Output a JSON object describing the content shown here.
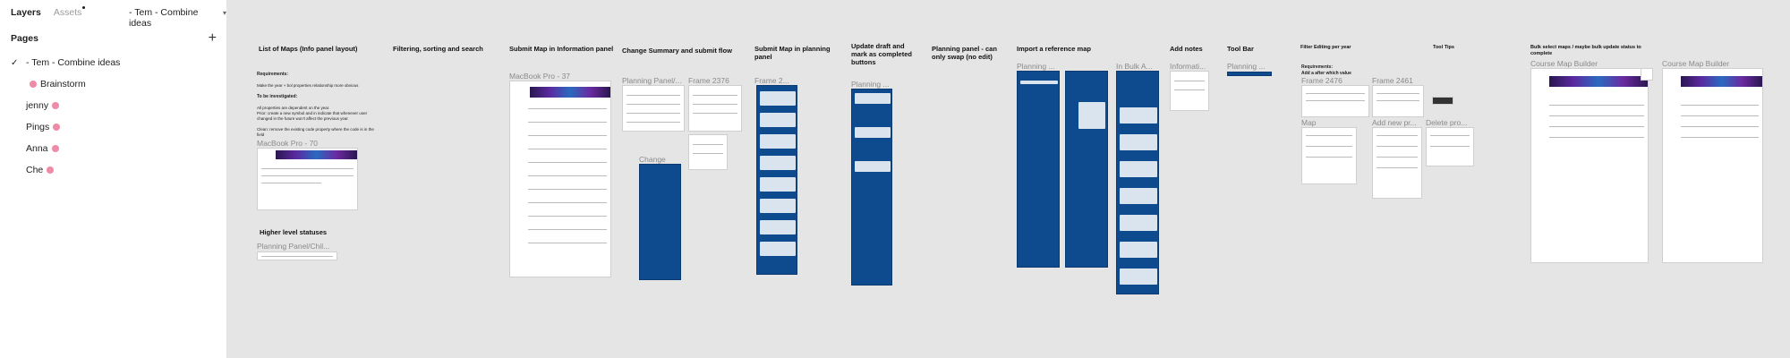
{
  "sidebar": {
    "tab_layers": "Layers",
    "tab_assets": "Assets",
    "file_title": "- Tem - Combine ideas",
    "pages_title": "Pages",
    "pages": [
      "- Tem - Combine ideas",
      "Brainstorm",
      "jenny",
      "Pings",
      "Anna",
      "Che"
    ]
  },
  "canvas": {
    "sections": [
      "List of Maps (Info panel layout)",
      "Filtering, sorting and search",
      "Submit Map in Information panel",
      "Change Summary and submit flow",
      "Submit Map in planning panel",
      "Update draft and mark as completed buttons",
      "Planning panel - can only swap (no edit)",
      "Import a reference map",
      "Add notes",
      "Tool Bar",
      "Filter Editing per year",
      "Tool Tips",
      "Bulk select maps / maybe bulk update status to complete",
      "Higher level statuses"
    ],
    "frames": [
      "MacBook Pro - 70",
      "MacBook Pro - 37",
      "Planning Panel/...",
      "Frame 2376",
      "Change",
      "Frame 2...",
      "Planning ...",
      "Planning ...",
      "In Bulk A...",
      "Informati...",
      "Planning ...",
      "Frame 2476",
      "Frame 2461",
      "Map",
      "Add new pr...",
      "Delete pro...",
      "Course Map Builder",
      "Course Map Builder",
      "Planning Panel/Chil..."
    ],
    "notes": {
      "requirements": "Requirements:",
      "req_line": "Make the year + bol properties relationship more obvious",
      "investigate": "To be investigated:",
      "inv_lines": [
        "All properties are dependent on the year.",
        "Prior: create a new symbol and in indicate that whenever user changed in the future won't affect the previous year",
        "Clean: remove the existing code property where the code is in the field"
      ],
      "filter_req": "Requirements:",
      "filter_req_line": "Add a after which value"
    }
  }
}
